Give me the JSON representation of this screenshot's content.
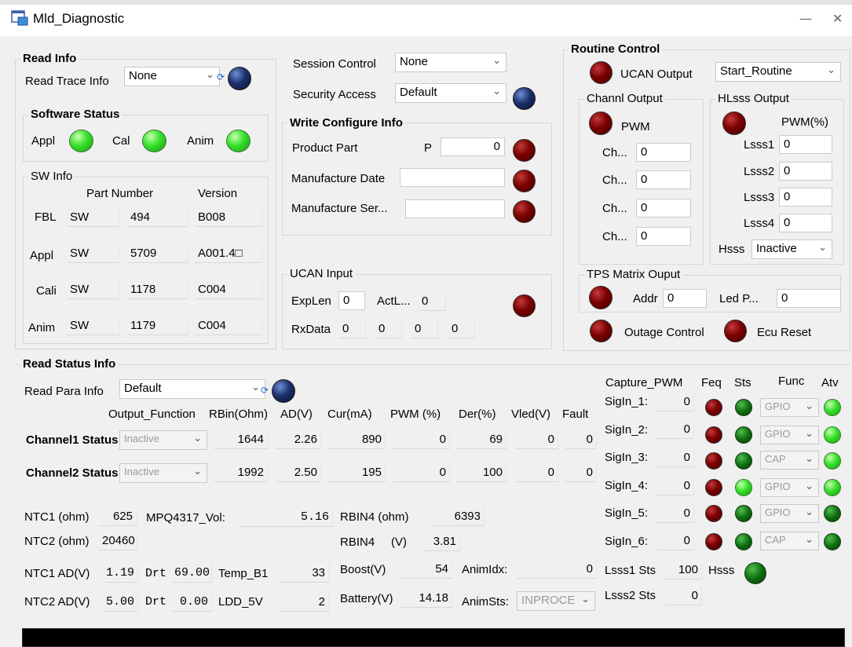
{
  "window": {
    "title": "Mld_Diagnostic",
    "minimize": "—",
    "close": "✕"
  },
  "read_info": {
    "title": "Read Info",
    "read_trace_label": "Read Trace Info",
    "read_trace_value": "None",
    "software_status": {
      "title": "Software Status",
      "appl": "Appl",
      "cal": "Cal",
      "anim": "Anim"
    },
    "sw_info": {
      "title": "SW Info",
      "col_part": "Part Number",
      "col_version": "Version",
      "rows": [
        {
          "label": "FBL",
          "prefix": "SW",
          "part": "494",
          "version": "B008"
        },
        {
          "label": "Appl",
          "prefix": "SW",
          "part": "5709",
          "version": "A001.4□"
        },
        {
          "label": "Cali",
          "prefix": "SW",
          "part": "1178",
          "version": "C004"
        },
        {
          "label": "Anim",
          "prefix": "SW",
          "part": "1179",
          "version": "C004"
        }
      ]
    }
  },
  "session": {
    "session_label": "Session Control",
    "session_value": "None",
    "security_label": "Security Access",
    "security_value": "Default"
  },
  "write_config": {
    "title": "Write Configure Info",
    "product_part_label": "Product Part",
    "product_part_prefix": "P",
    "product_part_value": "0",
    "manufacture_date_label": "Manufacture Date",
    "manufacture_date_value": "",
    "manufacture_serial_label": "Manufacture Ser...",
    "manufacture_serial_value": ""
  },
  "ucan_input": {
    "title": "UCAN Input",
    "explen_label": "ExpLen",
    "explen_value": "0",
    "actlen_label": "ActL...",
    "actlen_value": "0",
    "rxdata_label": "RxData",
    "rxdata": [
      "0",
      "0",
      "0",
      "0"
    ]
  },
  "routine": {
    "title": "Routine Control",
    "ucan_output_label": "UCAN Output",
    "routine_value": "Start_Routine",
    "channel_output": {
      "title": "Channl Output",
      "pwm_label": "PWM",
      "ch_label": "Ch...",
      "values": [
        "0",
        "0",
        "0",
        "0"
      ]
    },
    "hlsss_output": {
      "title": "HLsss Output",
      "pwm_label": "PWM(%)",
      "rows": [
        {
          "label": "Lsss1",
          "value": "0"
        },
        {
          "label": "Lsss2",
          "value": "0"
        },
        {
          "label": "Lsss3",
          "value": "0"
        },
        {
          "label": "Lsss4",
          "value": "0"
        }
      ],
      "hsss_label": "Hsss",
      "hsss_value": "Inactive"
    },
    "tps_matrix": {
      "title": "TPS Matrix Ouput",
      "addr_label": "Addr",
      "addr_value": "0",
      "led_label": "Led P...",
      "led_value": "0"
    },
    "outage_label": "Outage Control",
    "ecu_reset_label": "Ecu Reset"
  },
  "read_status": {
    "title": "Read Status Info",
    "read_para_label": "Read Para Info",
    "read_para_value": "Default",
    "headers": [
      "Output_Function",
      "RBin(Ohm)",
      "AD(V)",
      "Cur(mA)",
      "PWM (%)",
      "Der(%)",
      "Vled(V)",
      "Fault"
    ],
    "channels": [
      {
        "label": "Channel1 Status",
        "func": "Inactive",
        "rbin": "1644",
        "ad": "2.26",
        "cur": "890",
        "pwm": "0",
        "der": "69",
        "vled": "0",
        "fault": "0"
      },
      {
        "label": "Channel2 Status",
        "func": "Inactive",
        "rbin": "1992",
        "ad": "2.50",
        "cur": "195",
        "pwm": "0",
        "der": "100",
        "vled": "0",
        "fault": "0"
      }
    ],
    "ntc1_ohm_label": "NTC1 (ohm)",
    "ntc1_ohm_value": "625",
    "ntc2_ohm_label": "NTC2 (ohm)",
    "ntc2_ohm_value": "20460",
    "mpq_label": "MPQ4317_Vol:",
    "mpq_value": "5.16",
    "rbin4_ohm_label": "RBIN4 (ohm)",
    "rbin4_ohm_value": "6393",
    "rbin4_v_label": "RBIN4     (V)",
    "rbin4_v_value": "3.81",
    "ntc1_ad_label": "NTC1 AD(V)",
    "ntc1_ad_value": "1.19",
    "ntc2_ad_label": "NTC2 AD(V)",
    "ntc2_ad_value": "5.00",
    "drt_label": "Drt",
    "drt1_value": "69.00",
    "drt2_value": "0.00",
    "temp_label": "Temp_B1",
    "temp_value": "33",
    "ldd_label": "LDD_5V",
    "ldd_value": "2",
    "boost_label": "Boost(V)",
    "boost_value": "54",
    "battery_label": "Battery(V)",
    "battery_value": "14.18",
    "animidx_label": "AnimIdx:",
    "animidx_value": "0",
    "animsts_label": "AnimSts:",
    "animsts_value": "INPROCE"
  },
  "capture": {
    "title": "Capture_PWM",
    "headers": {
      "feq": "Feq",
      "sts": "Sts",
      "func": "Func",
      "atv": "Atv"
    },
    "rows": [
      {
        "label": "SigIn_1:",
        "value": "0",
        "func": "GPIO",
        "sts": "dark",
        "atv": "bright"
      },
      {
        "label": "SigIn_2:",
        "value": "0",
        "func": "GPIO",
        "sts": "dark",
        "atv": "bright"
      },
      {
        "label": "SigIn_3:",
        "value": "0",
        "func": "CAP",
        "sts": "dark",
        "atv": "bright"
      },
      {
        "label": "SigIn_4:",
        "value": "0",
        "func": "GPIO",
        "sts": "bright",
        "atv": "bright"
      },
      {
        "label": "SigIn_5:",
        "value": "0",
        "func": "GPIO",
        "sts": "dark",
        "atv": "dark"
      },
      {
        "label": "SigIn_6:",
        "value": "0",
        "func": "CAP",
        "sts": "dark",
        "atv": "dark"
      }
    ],
    "lsss1_sts_label": "Lsss1 Sts",
    "lsss1_sts_value": "100",
    "lsss2_sts_label": "Lsss2 Sts",
    "lsss2_sts_value": "0",
    "hsss_label": "Hsss"
  },
  "colors": {
    "led_red": "#7a0000",
    "led_green": "#35e02a",
    "led_blue": "#1c2f6b",
    "led_dark_green": "#0e6e0e"
  }
}
